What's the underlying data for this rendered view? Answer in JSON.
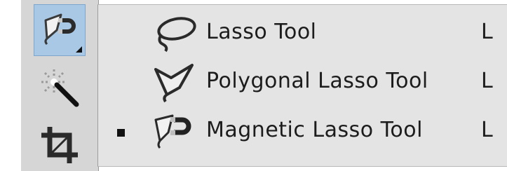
{
  "toolbar": {
    "tools": [
      {
        "icon": "magnetic-lasso-icon",
        "active": true
      },
      {
        "icon": "magic-wand-icon",
        "active": false
      },
      {
        "icon": "crop-icon",
        "active": false
      }
    ]
  },
  "flyout": {
    "items": [
      {
        "label": "Lasso Tool",
        "shortcut": "L",
        "icon": "lasso-icon",
        "selected": false
      },
      {
        "label": "Polygonal Lasso Tool",
        "shortcut": "L",
        "icon": "polygonal-lasso-icon",
        "selected": false
      },
      {
        "label": "Magnetic Lasso Tool",
        "shortcut": "L",
        "icon": "magnetic-lasso-icon",
        "selected": true
      }
    ]
  },
  "colors": {
    "toolbar_bg": "#d6d6d6",
    "active_tool_bg": "#a9c8e6",
    "flyout_bg": "#e4e4e4",
    "text": "#1c1c1c"
  }
}
